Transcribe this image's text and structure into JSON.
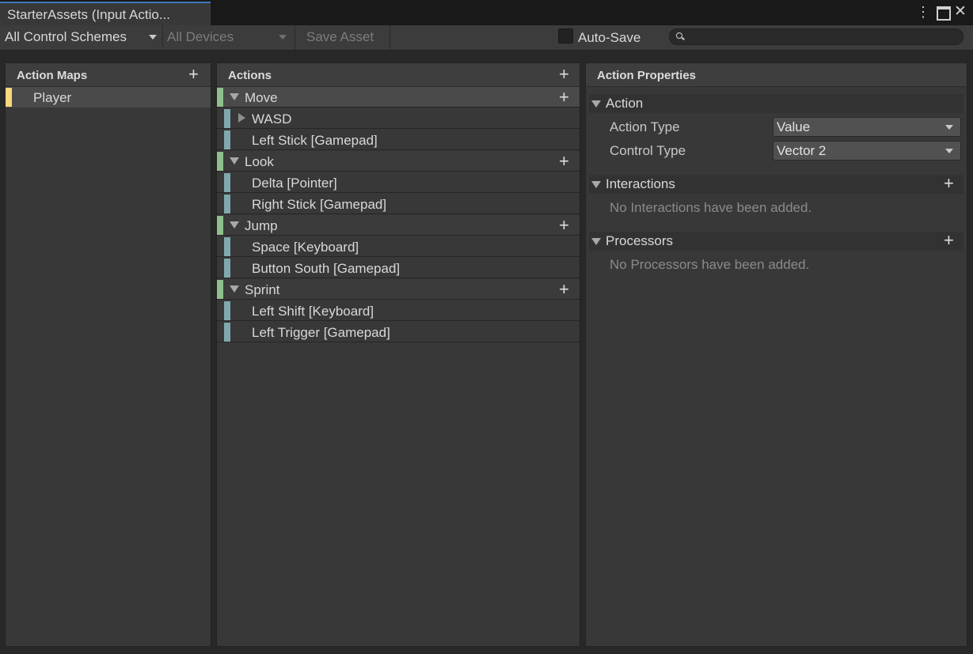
{
  "window": {
    "tab_title": "StarterAssets (Input Actio...",
    "menu_icon": "⋮",
    "maximize_icon": "□",
    "close_icon": "✕"
  },
  "toolbar": {
    "control_schemes": "All Control Schemes",
    "devices": "All Devices",
    "save_asset": "Save Asset",
    "auto_save": "Auto-Save",
    "search_placeholder": ""
  },
  "action_maps": {
    "title": "Action Maps",
    "items": [
      {
        "label": "Player",
        "selected": true
      }
    ]
  },
  "actions": {
    "title": "Actions",
    "items": [
      {
        "label": "Move",
        "bindings": [
          {
            "label": "WASD",
            "composite": true
          },
          {
            "label": "Left Stick [Gamepad]"
          }
        ]
      },
      {
        "label": "Look",
        "bindings": [
          {
            "label": "Delta [Pointer]"
          },
          {
            "label": "Right Stick [Gamepad]"
          }
        ]
      },
      {
        "label": "Jump",
        "bindings": [
          {
            "label": "Space [Keyboard]"
          },
          {
            "label": "Button South [Gamepad]"
          }
        ]
      },
      {
        "label": "Sprint",
        "bindings": [
          {
            "label": "Left Shift [Keyboard]"
          },
          {
            "label": "Left Trigger [Gamepad]"
          }
        ]
      }
    ]
  },
  "properties": {
    "title": "Action Properties",
    "action_section": "Action",
    "action_type_label": "Action Type",
    "action_type_value": "Value",
    "control_type_label": "Control Type",
    "control_type_value": "Vector 2",
    "interactions_section": "Interactions",
    "interactions_empty": "No Interactions have been added.",
    "processors_section": "Processors",
    "processors_empty": "No Processors have been added."
  },
  "colors": {
    "map_marker": "#f5d97a",
    "action_marker": "#8fbf8f",
    "binding_marker": "#7fa9ad",
    "tab_accent": "#3a79bb"
  }
}
